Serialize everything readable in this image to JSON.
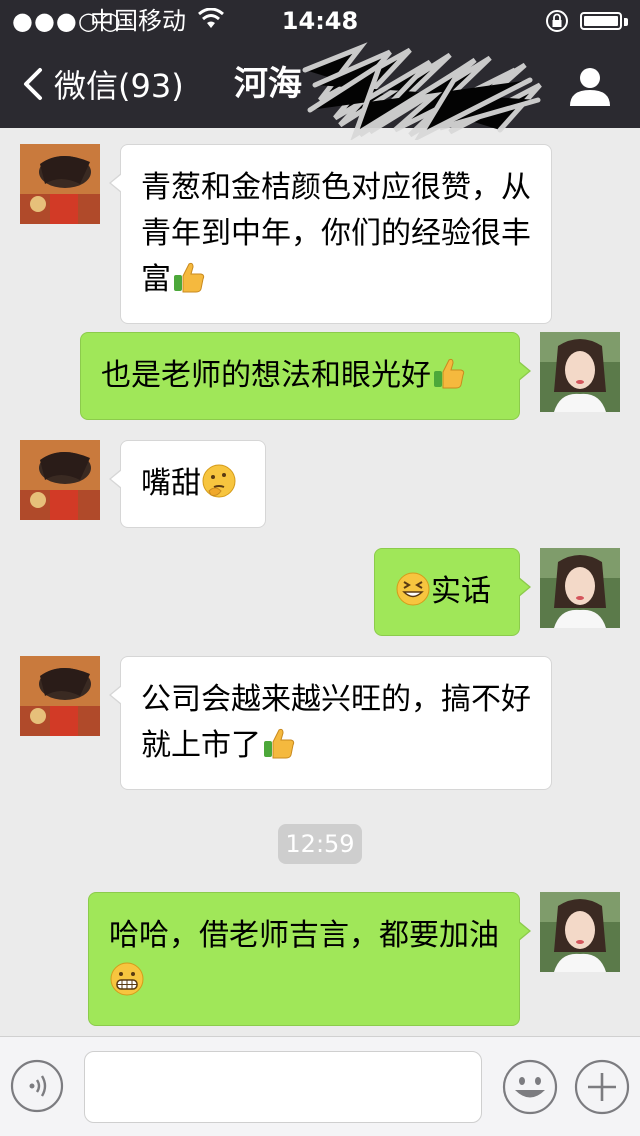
{
  "status_bar": {
    "signal": "●●●○○",
    "carrier": "中国移动",
    "wifi_icon": "wifi-icon",
    "time": "14:48",
    "lock_icon": "orientation-lock-icon",
    "battery_level": 1.0
  },
  "nav": {
    "back_label": "微信(93)",
    "title": "河海",
    "back_icon": "chevron-left-icon",
    "right_icon": "person-icon"
  },
  "messages": [
    {
      "side": "in",
      "text": "青葱和金桔颜色对应很赞，从青年到中年，你们的经验很丰富",
      "emoji": "thumbs-up"
    },
    {
      "side": "out",
      "text": "也是老师的想法和眼光好",
      "emoji": "thumbs-up"
    },
    {
      "side": "in",
      "text": "嘴甜",
      "emoji": "thinking-face"
    },
    {
      "side": "out",
      "text": "实话",
      "emoji": "grinning-squint-face",
      "emoji_position": "before"
    },
    {
      "side": "in",
      "text": "公司会越来越兴旺的，搞不好就上市了",
      "emoji": "thumbs-up"
    },
    {
      "side": "out",
      "text": "哈哈，借老师吉言，都要加油",
      "emoji": "grimacing-face"
    }
  ],
  "time_separator": "12:59",
  "input_bar": {
    "voice_icon": "voice-icon",
    "input_value": "",
    "emoji_icon": "smiley-icon",
    "plus_icon": "plus-icon"
  },
  "colors": {
    "nav_bg": "#2b2a30",
    "chat_bg": "#ebebeb",
    "incoming_bubble": "#ffffff",
    "outgoing_bubble": "#a0e759"
  }
}
